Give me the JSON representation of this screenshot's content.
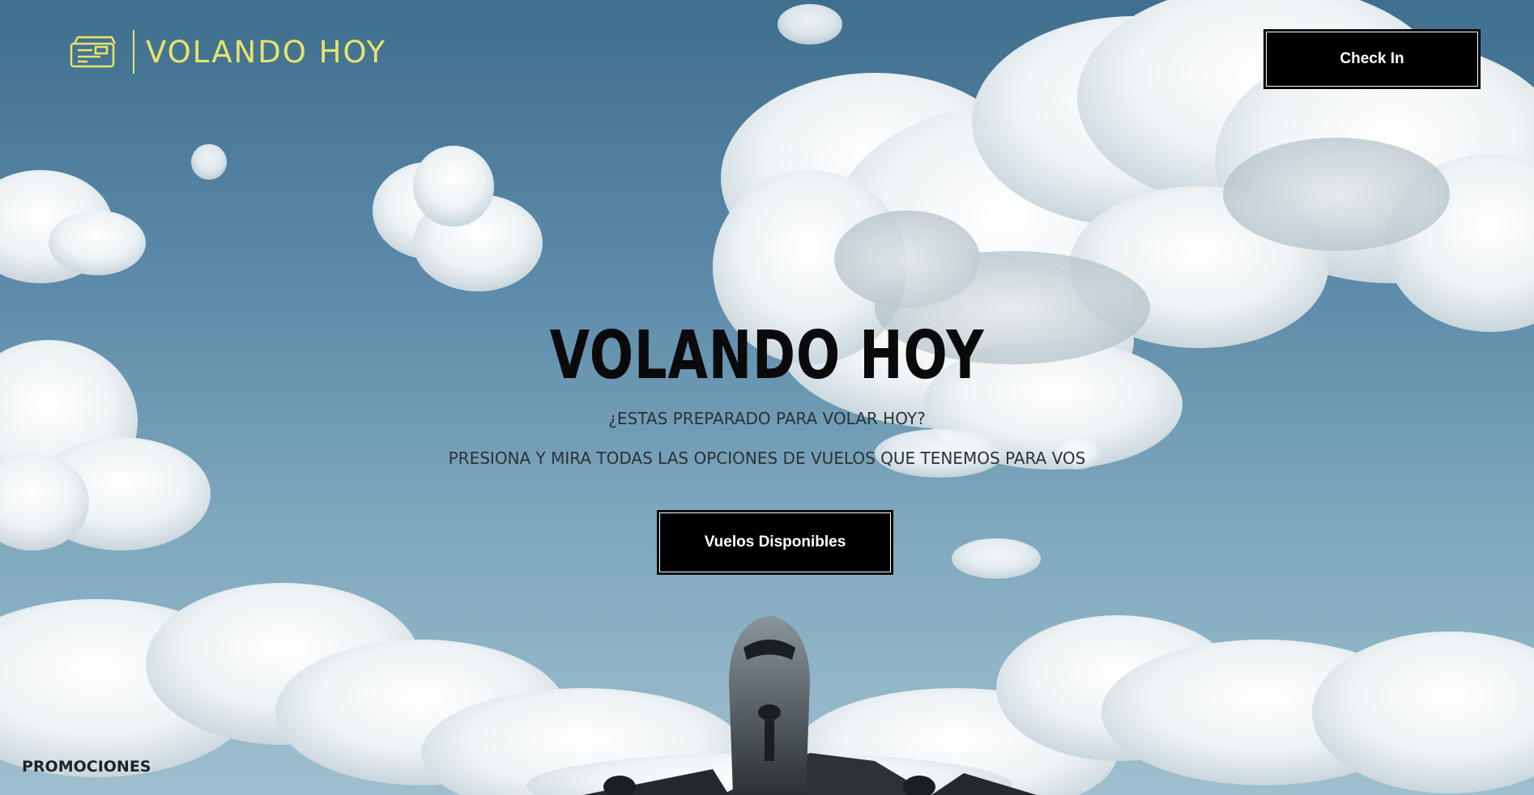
{
  "brand": {
    "name": "VOLANDO HOY",
    "logo_icon": "ticket-icon",
    "accent_color": "#e7e46a"
  },
  "header": {
    "checkin_label": "Check In"
  },
  "hero": {
    "title": "VOLANDO HOY",
    "subtitle": "¿ESTAS PREPARADO PARA VOLAR HOY?",
    "description": "PRESIONA Y MIRA TODAS LAS OPCIONES DE VUELOS QUE TENEMOS PARA VOS",
    "cta_label": "Vuelos Disponibles"
  },
  "footer": {
    "promo_label": "PROMOCIONES"
  },
  "colors": {
    "button_bg": "#000000",
    "button_text": "#ffffff",
    "text_dark": "#2b3136"
  }
}
